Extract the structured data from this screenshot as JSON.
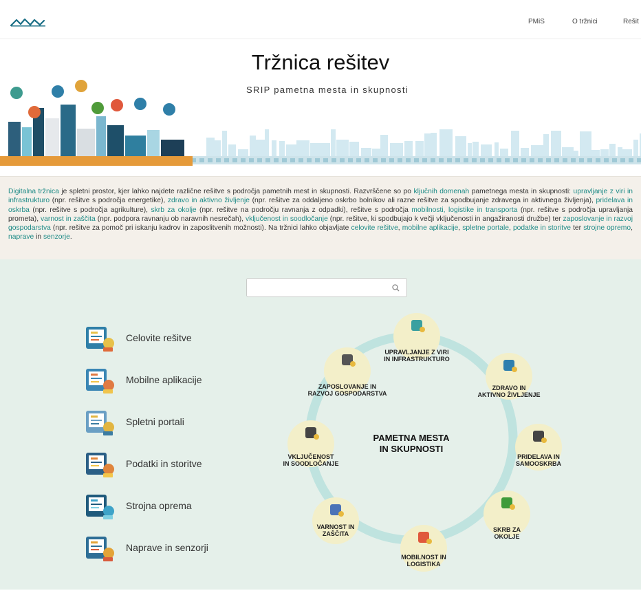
{
  "header": {
    "nav": [
      "PMiS",
      "O tržnici",
      "Rešit"
    ]
  },
  "hero": {
    "title": "Tržnica rešitev",
    "subtitle": "SRIP pametna mesta in skupnosti"
  },
  "intro": {
    "parts": [
      {
        "text": "Digitalna tržnica",
        "link": true
      },
      {
        "text": " je spletni prostor, kjer lahko najdete različne rešitve s področja pametnih mest in skupnosti. Razvrščene so po ",
        "link": false
      },
      {
        "text": "ključnih domenah",
        "link": true
      },
      {
        "text": " pametnega mesta in skupnosti: ",
        "link": false
      },
      {
        "text": "upravljanje z viri in infrastrukturo",
        "link": true
      },
      {
        "text": " (npr. rešitve s področja energetike), ",
        "link": false
      },
      {
        "text": "zdravo in aktivno življenje",
        "link": true
      },
      {
        "text": " (npr. rešitve za oddaljeno oskrbo bolnikov ali razne rešitve za spodbujanje zdravega in aktivnega življenja), ",
        "link": false
      },
      {
        "text": "pridelava in oskrba",
        "link": true
      },
      {
        "text": " (npr. rešitve s področja agrikulture), ",
        "link": false
      },
      {
        "text": "skrb za okolje",
        "link": true
      },
      {
        "text": " (npr. rešitve na področju ravnanja z odpadki), rešitve s področja ",
        "link": false
      },
      {
        "text": "mobilnosti, logistike in transporta",
        "link": true
      },
      {
        "text": " (npr. rešitve s področja upravljanja prometa), ",
        "link": false
      },
      {
        "text": "varnost in zaščita",
        "link": true
      },
      {
        "text": " (npr. podpora ravnanju ob naravnih nesrečah), ",
        "link": false
      },
      {
        "text": "vključenost in soodločanje",
        "link": true
      },
      {
        "text": " (npr. rešitve, ki spodbujajo k večji vključenosti in angažiranosti družbe) ter ",
        "link": false
      },
      {
        "text": "zaposlovanje in razvoj gospodarstva",
        "link": true
      },
      {
        "text": " (npr. rešitve za pomoč pri iskanju kadrov in zaposlitvenih možnosti). Na tržnici lahko objavljate ",
        "link": false
      },
      {
        "text": "celovite rešitve",
        "link": true
      },
      {
        "text": ", ",
        "link": false
      },
      {
        "text": "mobilne aplikacije",
        "link": true
      },
      {
        "text": ", ",
        "link": false
      },
      {
        "text": "spletne portale",
        "link": true
      },
      {
        "text": ", ",
        "link": false
      },
      {
        "text": "podatke in storitve",
        "link": true
      },
      {
        "text": " ter ",
        "link": false
      },
      {
        "text": "strojne opremo",
        "link": true
      },
      {
        "text": ", ",
        "link": false
      },
      {
        "text": "naprave",
        "link": true
      },
      {
        "text": " in ",
        "link": false
      },
      {
        "text": "senzorje",
        "link": true
      },
      {
        "text": ".",
        "link": false
      }
    ]
  },
  "search": {
    "placeholder": "",
    "icon": "search-icon"
  },
  "categories": [
    {
      "label": "Celovite rešitve",
      "icon": "complete-solutions-icon"
    },
    {
      "label": "Mobilne aplikacije",
      "icon": "mobile-apps-icon"
    },
    {
      "label": "Spletni portali",
      "icon": "web-portals-icon"
    },
    {
      "label": "Podatki in storitve",
      "icon": "data-services-icon"
    },
    {
      "label": "Strojna oprema",
      "icon": "hardware-icon"
    },
    {
      "label": "Naprave in senzorji",
      "icon": "devices-sensors-icon"
    }
  ],
  "domains": {
    "center": [
      "PAMETNA MESTA",
      "IN SKUPNOSTI"
    ],
    "nodes": [
      {
        "lines": [
          "UPRAVLJANJE Z VIRI",
          "IN INFRASTRUKTURO"
        ],
        "icon": "infrastructure-icon"
      },
      {
        "lines": [
          "ZDRAVO IN",
          "AKTIVNO ŽIVLJENJE"
        ],
        "icon": "running-shoe-icon"
      },
      {
        "lines": [
          "PRIDELAVA IN",
          "SAMOOSKRBA"
        ],
        "icon": "farmer-icon"
      },
      {
        "lines": [
          "SKRB ZA",
          "OKOLJE"
        ],
        "icon": "trees-icon"
      },
      {
        "lines": [
          "MOBILNOST IN",
          "LOGISTIKA"
        ],
        "icon": "map-pin-icon"
      },
      {
        "lines": [
          "VARNOST IN",
          "ZAŠČITA"
        ],
        "icon": "shield-icon"
      },
      {
        "lines": [
          "VKLJUČENOST",
          "IN SOODLOČANJE"
        ],
        "icon": "inclusion-icon"
      },
      {
        "lines": [
          "ZAPOSLOVANJE IN",
          "RAZVOJ GOSPODARSTVA"
        ],
        "icon": "workers-icon"
      }
    ]
  },
  "colors": {
    "link": "#1d8a86",
    "ring": "#bfe3df",
    "node_bg": "#f3efc9",
    "intro_bg": "#f4f0ea",
    "main_bg": "#e5f0ea"
  }
}
